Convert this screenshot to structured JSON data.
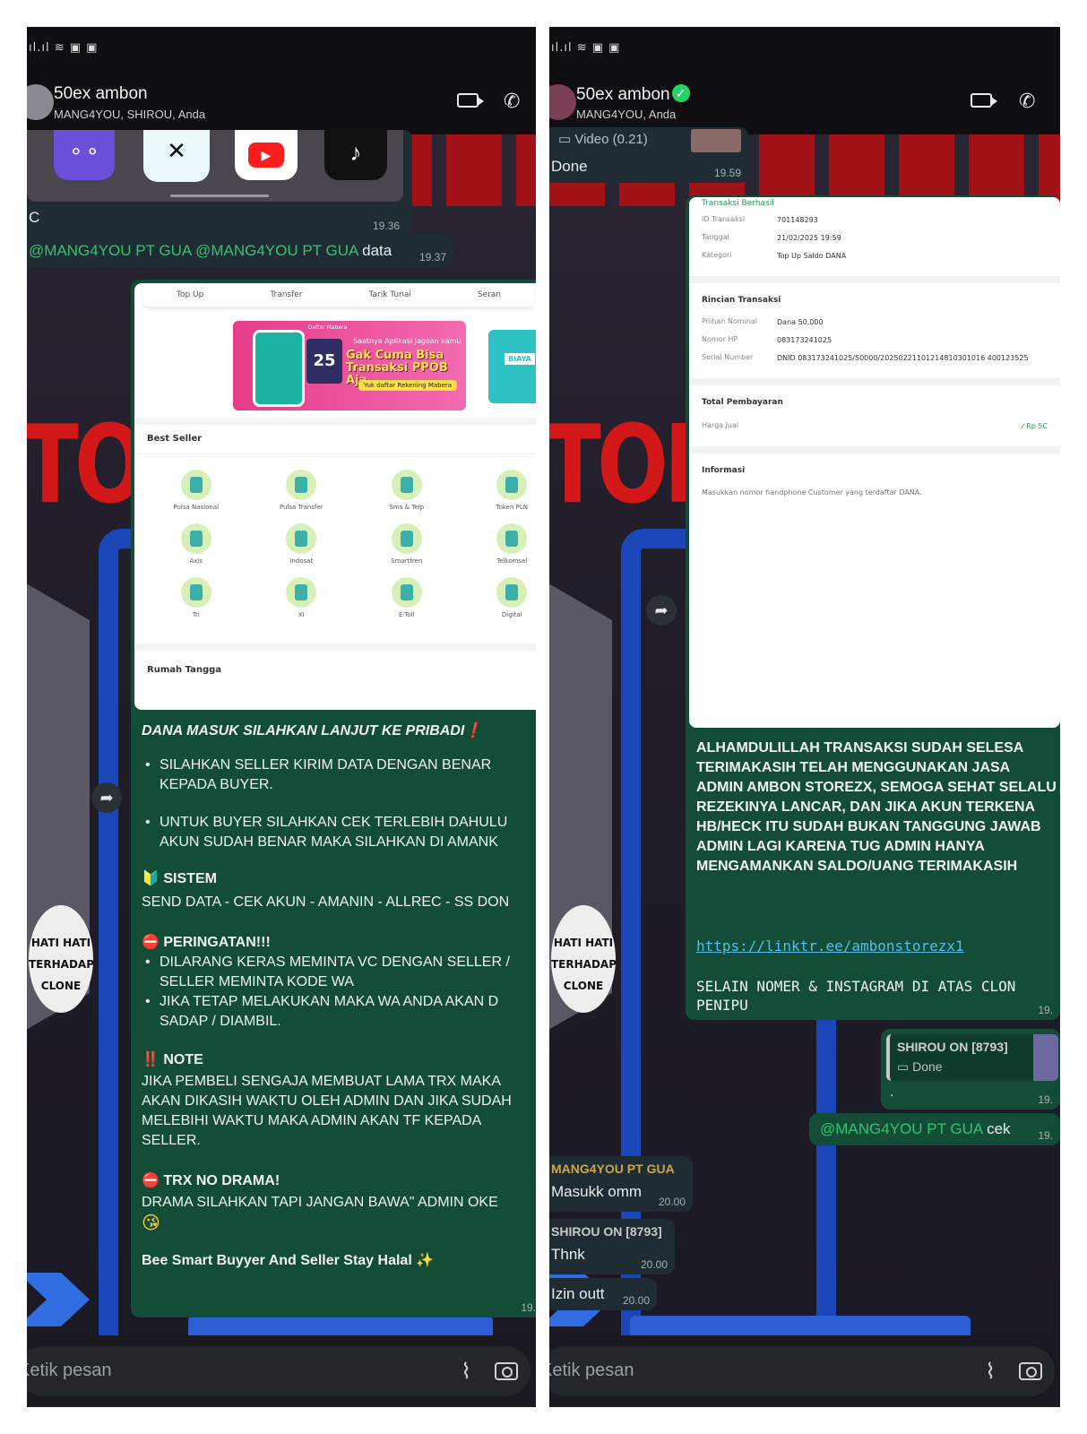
{
  "left": {
    "chat": {
      "title": "50ex ambon",
      "participants": "MANG4YOU, SHIROU, Anda"
    },
    "messages": {
      "prev_partial_text": "C",
      "prev_time": "19.36",
      "mention_1": "@MANG4YOU PT GUA",
      "mention_2": "@MANG4YOU PT GUA",
      "mention_text": "data",
      "mention_time": "19.37"
    },
    "screenshot": {
      "tabs": [
        "Top Up",
        "Transfer",
        "Tarik Tunai",
        "Seran"
      ],
      "promo": {
        "tag": "Daftar Mabera",
        "badge": "25",
        "line1": "Saatnya Aplikasi Jagoan kamu",
        "headline": "Gak Cuma Bisa Transaksi PPOB Aja",
        "cta": "Yuk daftar Rekening Mabera",
        "side": "BIAYA"
      },
      "best_seller_title": "Best Seller",
      "grid": [
        "Pulsa Nasional",
        "Pulsa Transfer",
        "Sms & Telp",
        "Token PLN",
        "Axis",
        "Indosat",
        "Smartfren",
        "Telkomsel",
        "Tri",
        "XI",
        "E-Toll",
        "Digital"
      ],
      "rumah_tangga_title": "Rumah Tangga"
    },
    "rules": {
      "header": "DANA MASUK SILAHKAN LANJUT KE PRIBADI",
      "header_emoji": "❗",
      "bullet1": "SILAHKAN SELLER KIRIM DATA DENGAN BENAR KEPADA BUYER.",
      "bullet2": "UNTUK BUYER SILAHKAN CEK TERLEBIH DAHULU AKUN SUDAH BENAR MAKA SILAHKAN  DI AMANK",
      "sistem_emoji": "🔰",
      "sistem_title": "SISTEM",
      "sistem_text": "SEND DATA - CEK AKUN - AMANIN - ALLREC - SS DON",
      "warn_emoji": "⛔",
      "warn_title": "PERINGATAN!!!",
      "warn1": "DILARANG KERAS MEMINTA VC DENGAN SELLER / SELLER MEMINTA KODE WA",
      "warn2": "JIKA TETAP MELAKUKAN MAKA WA ANDA AKAN D SADAP / DIAMBIL.",
      "note_emoji": "‼️",
      "note_title": "NOTE",
      "note_text": "JIKA PEMBELI SENGAJA MEMBUAT LAMA TRX MAKA AKAN DIKASIH WAKTU OLEH ADMIN DAN JIKA SUDAH MELEBIHI WAKTU MAKA ADMIN AKAN TF KEPADA SELLER.",
      "trx_emoji": "⛔",
      "trx_title": "TRX NO DRAMA!",
      "trx_text": "DRAMA SILAHKAN TAPI JANGAN BAWA\" ADMIN OKE",
      "kiss_emoji": "😘",
      "footer": "Bee Smart Buyyer And Seller Stay Halal",
      "footer_emoji": "✨",
      "time": "19."
    },
    "input": {
      "placeholder": "Ketik pesan"
    }
  },
  "right": {
    "chat": {
      "title": "50ex ambon",
      "participants": "MANG4YOU, Anda"
    },
    "top_message": {
      "video_label": "Video (0.21)",
      "text": "Done",
      "time": "19.59"
    },
    "receipt": {
      "status": "Transaksi Berhasil",
      "details": [
        {
          "key": "ID Transaksi",
          "value": "701148293"
        },
        {
          "key": "Tanggal",
          "value": "21/02/2025 19:59"
        },
        {
          "key": "Kategori",
          "value": "Top Up Saldo DANA"
        }
      ],
      "rincian_title": "Rincian Transaksi",
      "rincian": [
        {
          "key": "Pilihan Nominal",
          "value": "Dana 50.000"
        },
        {
          "key": "Nomor HP",
          "value": "083173241025"
        },
        {
          "key": "Serial Number",
          "value": "DNID 083173241025/50000/20250221101214810301016 400123525"
        }
      ],
      "total_title": "Total Pembayaran",
      "harga_key": "Harga Jual",
      "harga_val": "✓Rp 5C",
      "info_title": "Informasi",
      "info_text": "Masukkan nomor handphone Customer yang terdaftar DANA."
    },
    "admin_message": {
      "text": "ALHAMDULILLAH TRANSAKSI SUDAH SELESA TERIMAKASIH TELAH MENGGUNAKAN JASA ADMIN AMBON STOREZX, SEMOGA SEHAT SELALU REZEKINYA LANCAR, DAN JIKA AKUN TERKENA HB/HECK ITU SUDAH BUKAN TANGGUNG JAWAB ADMIN LAGI KARENA TUG ADMIN HANYA MENGAMANKAN SALDO/UANG TERIMAKASIH",
      "link": "https://linktr.ee/ambonstorezx1",
      "footer": "SELAIN NOMER & INSTAGRAM DI ATAS CLON PENIPU",
      "time": "19."
    },
    "reply": {
      "quoted_name": "SHIROU ON [8793]",
      "quoted_text": "Done",
      "text": ".",
      "time": "19."
    },
    "mention": {
      "name": "@MANG4YOU PT GUA",
      "text": "cek",
      "time": "19."
    },
    "msg_mang": {
      "sender": "MANG4YOU PT GUA",
      "text": "Masukk omm",
      "time": "20.00"
    },
    "msg_shirou": {
      "sender": "SHIROU ON [8793]",
      "text": "Thnk",
      "time": "20.00"
    },
    "msg_izin": {
      "text": "Izin outt",
      "time": "20.00"
    },
    "input": {
      "placeholder": "Ketik pesan"
    }
  },
  "colors": {
    "incoming_bubble": "#1f2c34",
    "outgoing_bubble": "#144d37",
    "mention": "#37c26f",
    "link": "#53bdeb"
  }
}
